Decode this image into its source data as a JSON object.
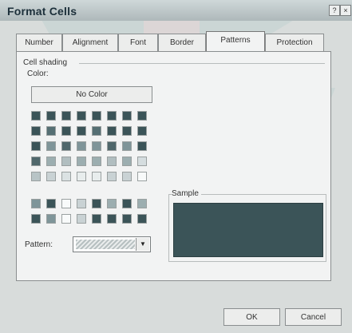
{
  "window": {
    "title": "Format Cells",
    "help_icon": "?",
    "close_icon": "×"
  },
  "tabs": [
    {
      "label": "Number",
      "active": false
    },
    {
      "label": "Alignment",
      "active": false
    },
    {
      "label": "Font",
      "active": false
    },
    {
      "label": "Border",
      "active": false
    },
    {
      "label": "Patterns",
      "active": true
    },
    {
      "label": "Protection",
      "active": false
    }
  ],
  "patterns": {
    "cell_shading_label": "Cell shading",
    "color_label": "Color:",
    "no_color_label": "No Color",
    "sample_label": "Sample",
    "pattern_label": "Pattern:",
    "selected_sample_color": "#3b5458",
    "palette_rows": [
      [
        "#3b5458",
        "#3b5458",
        "#3b5458",
        "#3b5458",
        "#3b5458",
        "#3b5458",
        "#3b5458",
        "#3b5458"
      ],
      [
        "#3b5458",
        "#556f73",
        "#3b5458",
        "#3b5458",
        "#556f73",
        "#3b5458",
        "#3b5458",
        "#3b5458"
      ],
      [
        "#3b5458",
        "#7f9599",
        "#4f676b",
        "#7f9599",
        "#7f9599",
        "#4f676b",
        "#7f9599",
        "#3b5458"
      ],
      [
        "#4f676b",
        "#9caeb0",
        "#b1bec0",
        "#9caeb0",
        "#9caeb0",
        "#b1bec0",
        "#9caeb0",
        "#d5dddf"
      ],
      [
        "#b8c4c6",
        "#c9d2d4",
        "#dbe2e3",
        "#e8eded",
        "#e8eded",
        "#c9d2d4",
        "#c9d2d4",
        "#f8fafa"
      ]
    ],
    "palette_rows_bottom": [
      [
        "#7f9599",
        "#3b5458",
        "#f8fafa",
        "#c9d2d4",
        "#3b5458",
        "#9caeb0",
        "#3b5458",
        "#9caeb0"
      ],
      [
        "#3b5458",
        "#7f9599",
        "#f8fafa",
        "#c9d2d4",
        "#3b5458",
        "#3b5458",
        "#3b5458",
        "#3b5458"
      ]
    ]
  },
  "buttons": {
    "ok_label": "OK",
    "cancel_label": "Cancel"
  }
}
